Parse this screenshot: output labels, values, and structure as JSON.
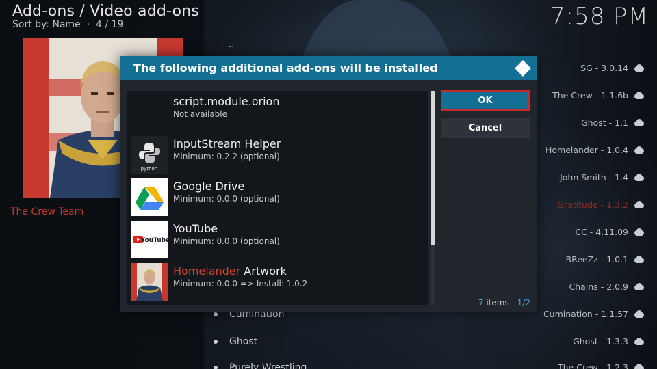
{
  "header": {
    "breadcrumb": "Add-ons / Video add-ons",
    "sort_label": "Sort by: Name",
    "position": "4 / 19",
    "clock": "7:58 PM"
  },
  "left": {
    "poster_caption": "The Crew Team"
  },
  "background_list": {
    "parent_item": "..",
    "items": [
      "Cumination",
      "Ghost",
      "Purely Wrestling"
    ]
  },
  "right_list": [
    {
      "label": "SG - 3.0.14",
      "icon": "cloud-download-icon"
    },
    {
      "label": "The Crew - 1.1.6b",
      "icon": "cloud-download-icon"
    },
    {
      "label": "Ghost - 1.1",
      "icon": "cloud-download-icon"
    },
    {
      "label": "Homelander - 1.0.4",
      "icon": "cloud-download-icon"
    },
    {
      "label": "John Smith - 1.4",
      "icon": "cloud-download-icon"
    },
    {
      "label": "Gratitude - 1.3.2",
      "icon": "cloud-download-icon"
    },
    {
      "label": "CC - 4.11.09",
      "icon": "cloud-download-icon"
    },
    {
      "label": "BReeZz - 1.0.1",
      "icon": "cloud-download-icon"
    },
    {
      "label": "Chains - 2.0.9",
      "icon": "cloud-download-icon"
    },
    {
      "label": "Cumination - 1.1.57",
      "icon": "cloud-download-icon"
    },
    {
      "label": "Ghost - 1.3.3",
      "icon": "cloud-download-icon"
    },
    {
      "label": "The Crew - 1.2.3",
      "icon": "cloud-download-icon"
    }
  ],
  "dialog": {
    "title": "The following additional add-ons will be installed",
    "ok_label": "OK",
    "cancel_label": "Cancel",
    "items_count": "7",
    "items_word": "items",
    "page": "1/2",
    "addons": [
      {
        "name": "script.module.orion",
        "sub": "Not available",
        "thumb": "none"
      },
      {
        "name": "InputStream Helper",
        "sub": "Minimum: 0.2.2 (optional)",
        "thumb": "python-logo"
      },
      {
        "name": "Google Drive",
        "sub": "Minimum: 0.0.0 (optional)",
        "thumb": "google-drive-logo"
      },
      {
        "name": "YouTube",
        "sub": "Minimum: 0.0.0 (optional)",
        "thumb": "youtube-logo"
      },
      {
        "name_highlight": "Homelander",
        "name_rest": " Artwork",
        "sub": "Minimum: 0.0.0 => Install: 1.0.2",
        "thumb": "homelander-art"
      }
    ],
    "python_caption": "python",
    "youtube_word": "YouTube"
  },
  "colors": {
    "accent_blue": "#137094",
    "focus_red": "#c32a2a",
    "highlight_red": "#d2442f"
  }
}
